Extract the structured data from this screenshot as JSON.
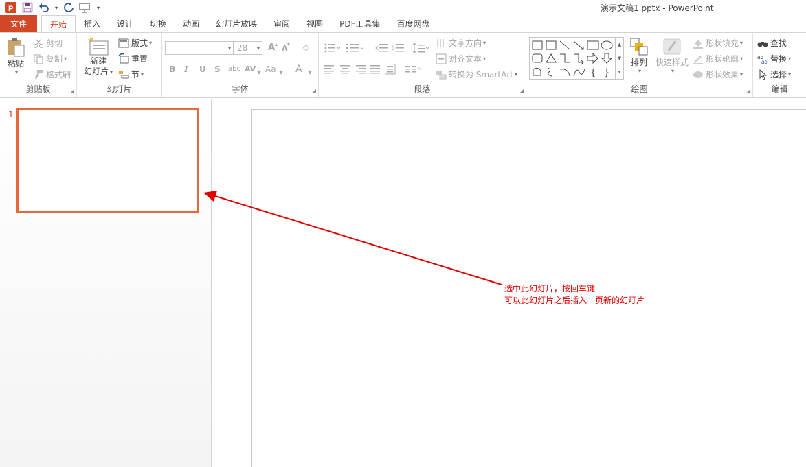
{
  "window": {
    "title": "演示文稿1.pptx - PowerPoint"
  },
  "qat": {
    "icons": [
      "powerpoint-logo-icon",
      "save-icon",
      "undo-icon",
      "redo-icon",
      "start-from-beginning-icon",
      "customize-qat-icon"
    ]
  },
  "tabs": [
    {
      "label": "文件"
    },
    {
      "label": "开始"
    },
    {
      "label": "插入"
    },
    {
      "label": "设计"
    },
    {
      "label": "切换"
    },
    {
      "label": "动画"
    },
    {
      "label": "幻灯片放映"
    },
    {
      "label": "审阅"
    },
    {
      "label": "视图"
    },
    {
      "label": "PDF工具集"
    },
    {
      "label": "百度网盘"
    }
  ],
  "ribbon": {
    "clipboard": {
      "label": "剪贴板",
      "paste": "粘贴",
      "cut": "剪切",
      "copy": "复制",
      "format_painter": "格式刷"
    },
    "slides": {
      "label": "幻灯片",
      "new_slide_line1": "新建",
      "new_slide_line2": "幻灯片",
      "layout": "版式",
      "reset": "重置",
      "section": "节"
    },
    "font": {
      "label": "字体",
      "font_name": "",
      "font_size": "28",
      "grow": "A",
      "shrink": "A",
      "bold": "B",
      "italic": "I",
      "underline": "U",
      "shadow": "S",
      "strike": "abc",
      "spacing": "AV",
      "case": "Aa",
      "color": "A"
    },
    "paragraph": {
      "label": "段落",
      "text_direction": "文字方向",
      "align_text": "对齐文本",
      "smartart": "转换为 SmartArt"
    },
    "drawing": {
      "label": "绘图",
      "arrange": "排列",
      "quick_styles": "快速样式",
      "shape_fill": "形状填充",
      "shape_outline": "形状轮廓",
      "shape_effects": "形状效果"
    },
    "editing": {
      "label": "编辑",
      "find": "查找",
      "replace": "替换",
      "select": "选择"
    }
  },
  "slides_panel": {
    "slide_number": "1"
  },
  "annotation": {
    "line1": "选中此幻灯片，按回车键",
    "line2": "可以此幻灯片之后插入一页新的幻灯片"
  },
  "colors": {
    "accent": "#d24726",
    "thumb_border": "#e8673d",
    "annotation": "#e00000"
  }
}
